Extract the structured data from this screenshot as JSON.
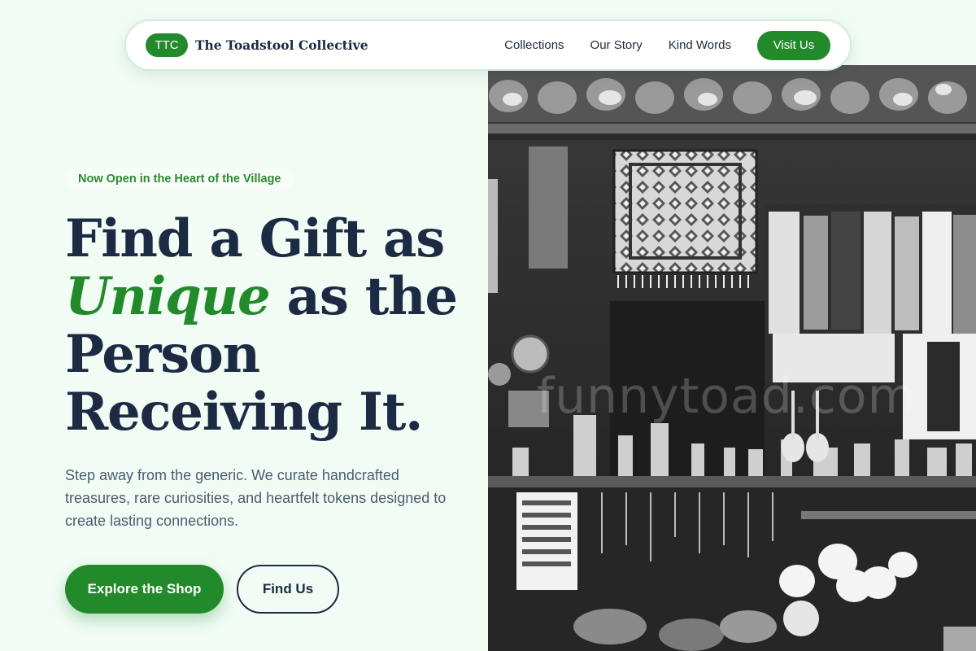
{
  "nav": {
    "logo_badge": "TTC",
    "brand_name": "The Toadstool Collective",
    "links": [
      "Collections",
      "Our Story",
      "Kind Words"
    ],
    "visit_label": "Visit Us"
  },
  "hero": {
    "eyebrow": "Now Open in the Heart of the Village",
    "headline_line1": "Find a Gift as",
    "headline_accent": "Unique",
    "headline_line2_rest": " as the",
    "headline_line3": "Person",
    "headline_line4": "Receiving It.",
    "subcopy": "Step away from the generic. We curate handcrafted treasures, rare curiosities, and heartfelt tokens designed to create lasting connections.",
    "cta_primary": "Explore the Shop",
    "cta_secondary": "Find Us"
  },
  "photo": {
    "watermark": "funnytoad.com"
  },
  "colors": {
    "brand_green": "#238a2b",
    "navy": "#1c2a44",
    "page_bg": "#f1fcf5"
  }
}
